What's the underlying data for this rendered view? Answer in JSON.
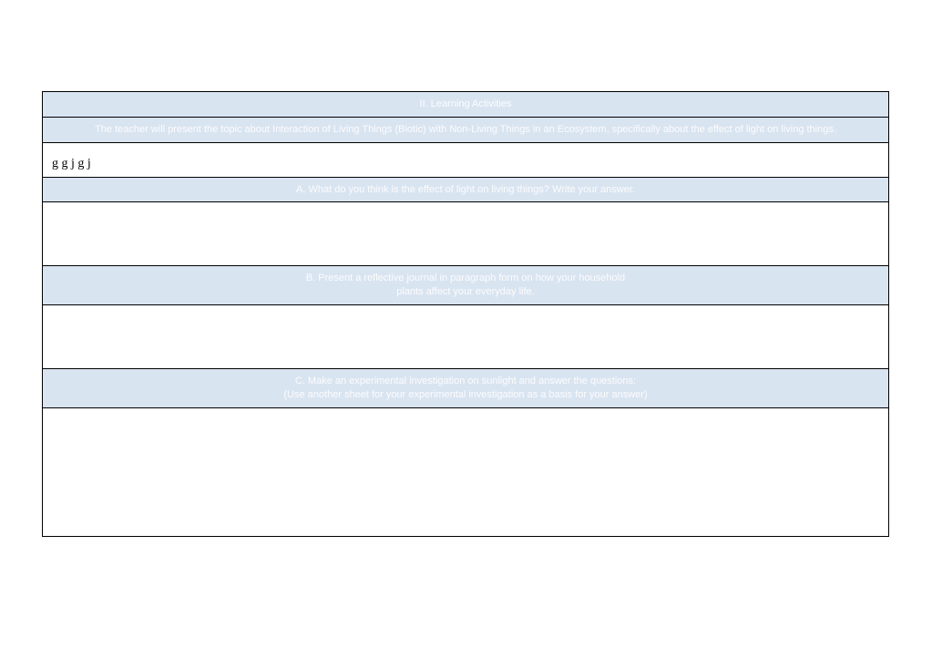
{
  "section": {
    "title": "II. Learning Activities",
    "intro": "The teacher will present the topic about Interaction of Living Things (Biotic) with Non-Living Things in an Ecosystem, specifically about the effect of light on living things.",
    "fragment_line": "g              g                j         g          j",
    "q_a": {
      "prompt": "A. What do you think is the effect of light on living things? Write your answer.",
      "answer": ""
    },
    "q_b": {
      "prompt_line1": "B. Present a reflective journal in paragraph form on how your household",
      "prompt_line2": "plants affect your everyday life.",
      "answer": ""
    },
    "q_c": {
      "prompt_line1": "C. Make an experimental investigation on sunlight and answer the questions:",
      "prompt_line2": "(Use another sheet for your experimental investigation as a basis for your answer)",
      "answer": ""
    }
  }
}
